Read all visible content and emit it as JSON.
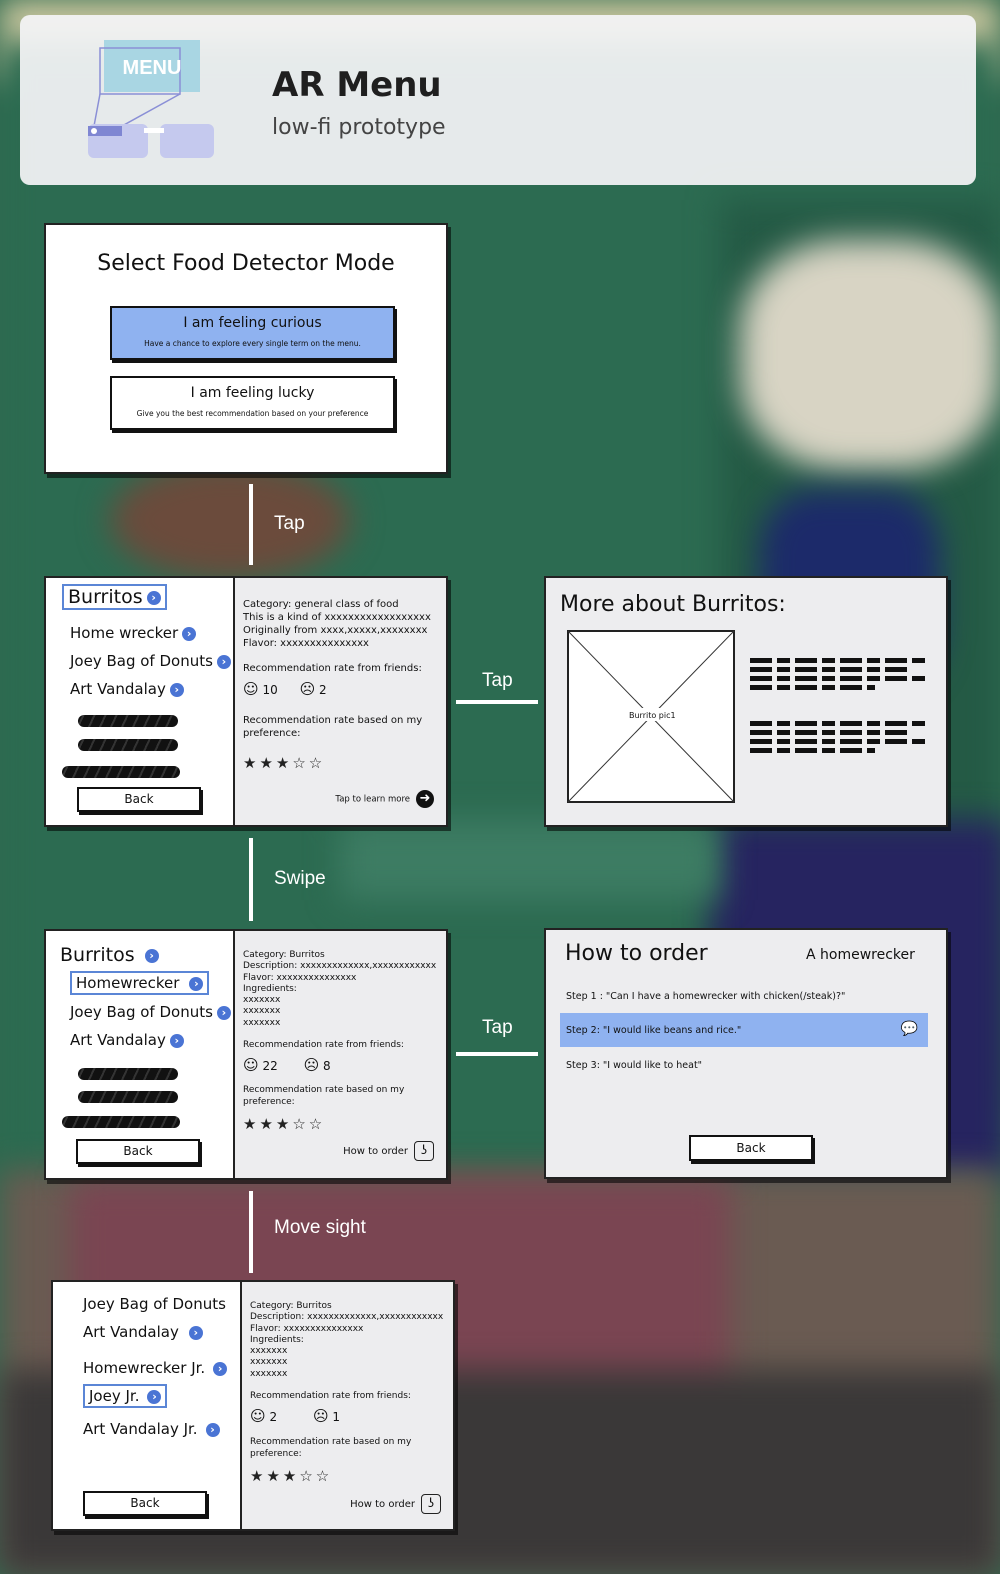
{
  "header": {
    "logo_text": "MENU",
    "title": "AR Menu",
    "subtitle": "low-fi prototype"
  },
  "connectors": {
    "tap1": "Tap",
    "tap2": "Tap",
    "tap3": "Tap",
    "swipe": "Swipe",
    "move_sight": "Move sight"
  },
  "screen1": {
    "title": "Select Food Detector Mode",
    "curious": {
      "label": "I am feeling curious",
      "sub": "Have a chance to explore every single term on the menu."
    },
    "lucky": {
      "label": "I am feeling lucky",
      "sub": "Give you the best recommendation based on your preference"
    }
  },
  "screen2": {
    "items": [
      "Burritos",
      "Home wrecker",
      "Joey Bag of Donuts",
      "Art Vandalay"
    ],
    "back": "Back",
    "lines": [
      "Category: general class of food",
      "This is a kind of xxxxxxxxxxxxxxxxxx",
      "Originally from xxxx,xxxxx,xxxxxxxx",
      "Flavor: xxxxxxxxxxxxxxx"
    ],
    "rec_friends": "Recommendation rate from friends:",
    "likes": "10",
    "dislikes": "2",
    "rec_pref": "Recommendation rate based on my preference:",
    "stars": "★★★☆☆",
    "learn_more": "Tap to learn more"
  },
  "screen3": {
    "title": "More about Burritos:",
    "image_label": "Burrito pic1"
  },
  "screen4": {
    "items": [
      "Burritos",
      "Homewrecker",
      "Joey Bag of Donuts",
      "Art Vandalay"
    ],
    "back": "Back",
    "lines": [
      "Category: Burritos",
      "Description: xxxxxxxxxxxxx,xxxxxxxxxxxx",
      "Flavor: xxxxxxxxxxxxxxx",
      "Ingredients:",
      "xxxxxxx",
      "xxxxxxx",
      "xxxxxxx"
    ],
    "rec_friends": "Recommendation rate from friends:",
    "likes": "22",
    "dislikes": "8",
    "rec_pref": "Recommendation rate based on my preference:",
    "stars": "★★★☆☆",
    "how_to_order": "How to order"
  },
  "screen5": {
    "title": "How to order",
    "item": "A homewrecker",
    "steps": [
      "Step 1 : \"Can I have a homewrecker with chicken(/steak)?\"",
      "Step 2: \"I would like beans and rice.\"",
      "Step 3: \"I would like to heat\""
    ],
    "back": "Back"
  },
  "screen6": {
    "items": [
      "Joey Bag of Donuts",
      "Art Vandalay",
      "Homewrecker Jr.",
      "Joey Jr.",
      "Art Vandalay Jr."
    ],
    "back": "Back",
    "lines": [
      "Category: Burritos",
      "Description: xxxxxxxxxxxxx,xxxxxxxxxxxx",
      "Flavor: xxxxxxxxxxxxxxx",
      "Ingredients:",
      "xxxxxxx",
      "xxxxxxx",
      "xxxxxxx"
    ],
    "rec_friends": "Recommendation rate from friends:",
    "likes": "2",
    "dislikes": "1",
    "rec_pref": "Recommendation rate based on my preference:",
    "stars": "★★★☆☆",
    "how_to_order": "How to order"
  },
  "colors": {
    "highlight": "#8fb2f0",
    "selection_border": "#5b86d6",
    "chevron": "#4a74d4",
    "board_green": "#2c6b51"
  },
  "icons": [
    "chevron-right-icon",
    "smile-icon",
    "frown-icon",
    "star-icon",
    "arrow-right-circle-icon",
    "ear-icon",
    "speech-bubble-icon",
    "ar-glasses-icon"
  ]
}
